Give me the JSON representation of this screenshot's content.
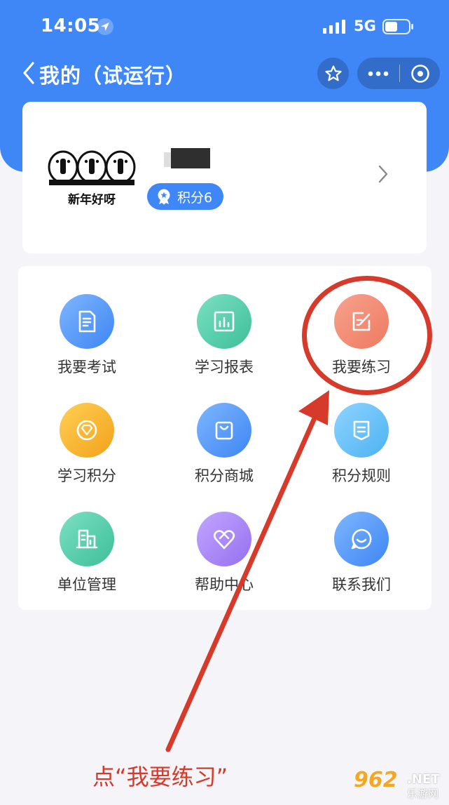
{
  "status_bar": {
    "time": "14:05",
    "network": "5G"
  },
  "nav": {
    "title": "我的（试运行）"
  },
  "profile": {
    "avatar_caption": "新年好呀",
    "points_label": "积分6"
  },
  "menu": {
    "items": [
      {
        "label": "我要考试",
        "icon": "exam-icon",
        "color_a": "#7fb6ff",
        "color_b": "#3d86f3"
      },
      {
        "label": "学习报表",
        "icon": "report-icon",
        "color_a": "#7ce0c3",
        "color_b": "#3dbf99"
      },
      {
        "label": "我要练习",
        "icon": "practice-icon",
        "color_a": "#f7a28e",
        "color_b": "#ee7a60"
      },
      {
        "label": "学习积分",
        "icon": "points-icon",
        "color_a": "#ffcf55",
        "color_b": "#f2a21a"
      },
      {
        "label": "积分商城",
        "icon": "shop-icon",
        "color_a": "#7fb6ff",
        "color_b": "#3d86f3"
      },
      {
        "label": "积分规则",
        "icon": "rules-icon",
        "color_a": "#8fd4ff",
        "color_b": "#4db2f2"
      },
      {
        "label": "单位管理",
        "icon": "building-icon",
        "color_a": "#7ce0c3",
        "color_b": "#3dbf99"
      },
      {
        "label": "帮助中心",
        "icon": "help-icon",
        "color_a": "#c3a6ff",
        "color_b": "#9470f0"
      },
      {
        "label": "联系我们",
        "icon": "contact-icon",
        "color_a": "#7fb6ff",
        "color_b": "#3d86f3"
      }
    ]
  },
  "annotation": {
    "text": "点“我要练习”"
  },
  "watermark": {
    "main": "962",
    "net": ".NET",
    "sub": "乐游网"
  },
  "colors": {
    "brand_blue": "#3f86f7",
    "annotation_red": "#d63a2a"
  }
}
